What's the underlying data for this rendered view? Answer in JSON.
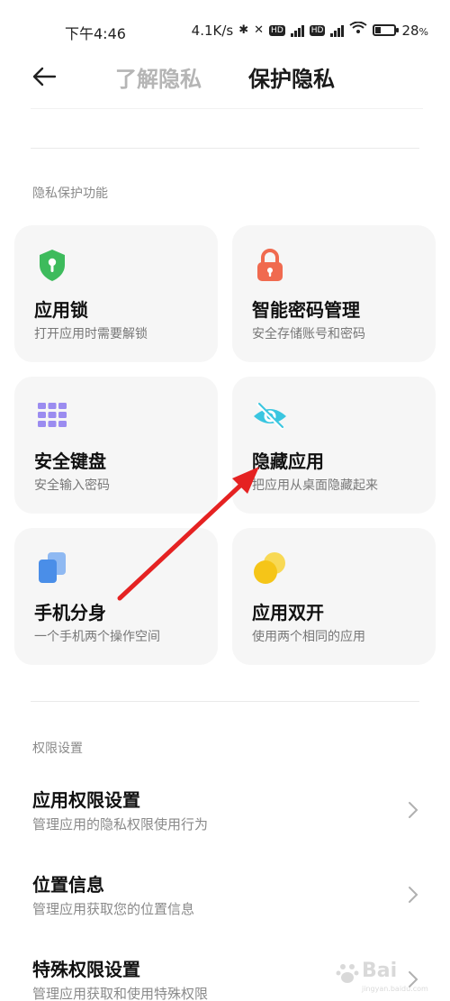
{
  "status_bar": {
    "time": "下午4:46",
    "speed": "4.1K/s",
    "battery": "28",
    "battery_unit": "%"
  },
  "header": {
    "tab_about": "了解隐私",
    "tab_protect": "保护隐私"
  },
  "privacy_section": {
    "title": "隐私保护功能",
    "cards": [
      {
        "title": "应用锁",
        "subtitle": "打开应用时需要解锁",
        "icon": "shield-lock-icon",
        "color": "#3dbb5c"
      },
      {
        "title": "智能密码管理",
        "subtitle": "安全存储账号和密码",
        "icon": "padlock-icon",
        "color": "#f06a4f"
      },
      {
        "title": "安全键盘",
        "subtitle": "安全输入密码",
        "icon": "keypad-icon",
        "color": "#9b8cf0"
      },
      {
        "title": "隐藏应用",
        "subtitle": "把应用从桌面隐藏起来",
        "icon": "eye-hidden-icon",
        "color": "#3ac6e0"
      },
      {
        "title": "手机分身",
        "subtitle": "一个手机两个操作空间",
        "icon": "dual-space-icon",
        "color": "#4a8ee8"
      },
      {
        "title": "应用双开",
        "subtitle": "使用两个相同的应用",
        "icon": "dual-apps-icon",
        "color": "#f5c518"
      }
    ]
  },
  "permission_section": {
    "title": "权限设置",
    "items": [
      {
        "title": "应用权限设置",
        "subtitle": "管理应用的隐私权限使用行为"
      },
      {
        "title": "位置信息",
        "subtitle": "管理应用获取您的位置信息"
      },
      {
        "title": "特殊权限设置",
        "subtitle": "管理应用获取和使用特殊权限"
      }
    ]
  },
  "watermark": {
    "text": "Bai",
    "sub": "jingyan.baidu.com"
  },
  "colors": {
    "arrow": "#e52222",
    "card_bg": "#f6f6f6"
  }
}
